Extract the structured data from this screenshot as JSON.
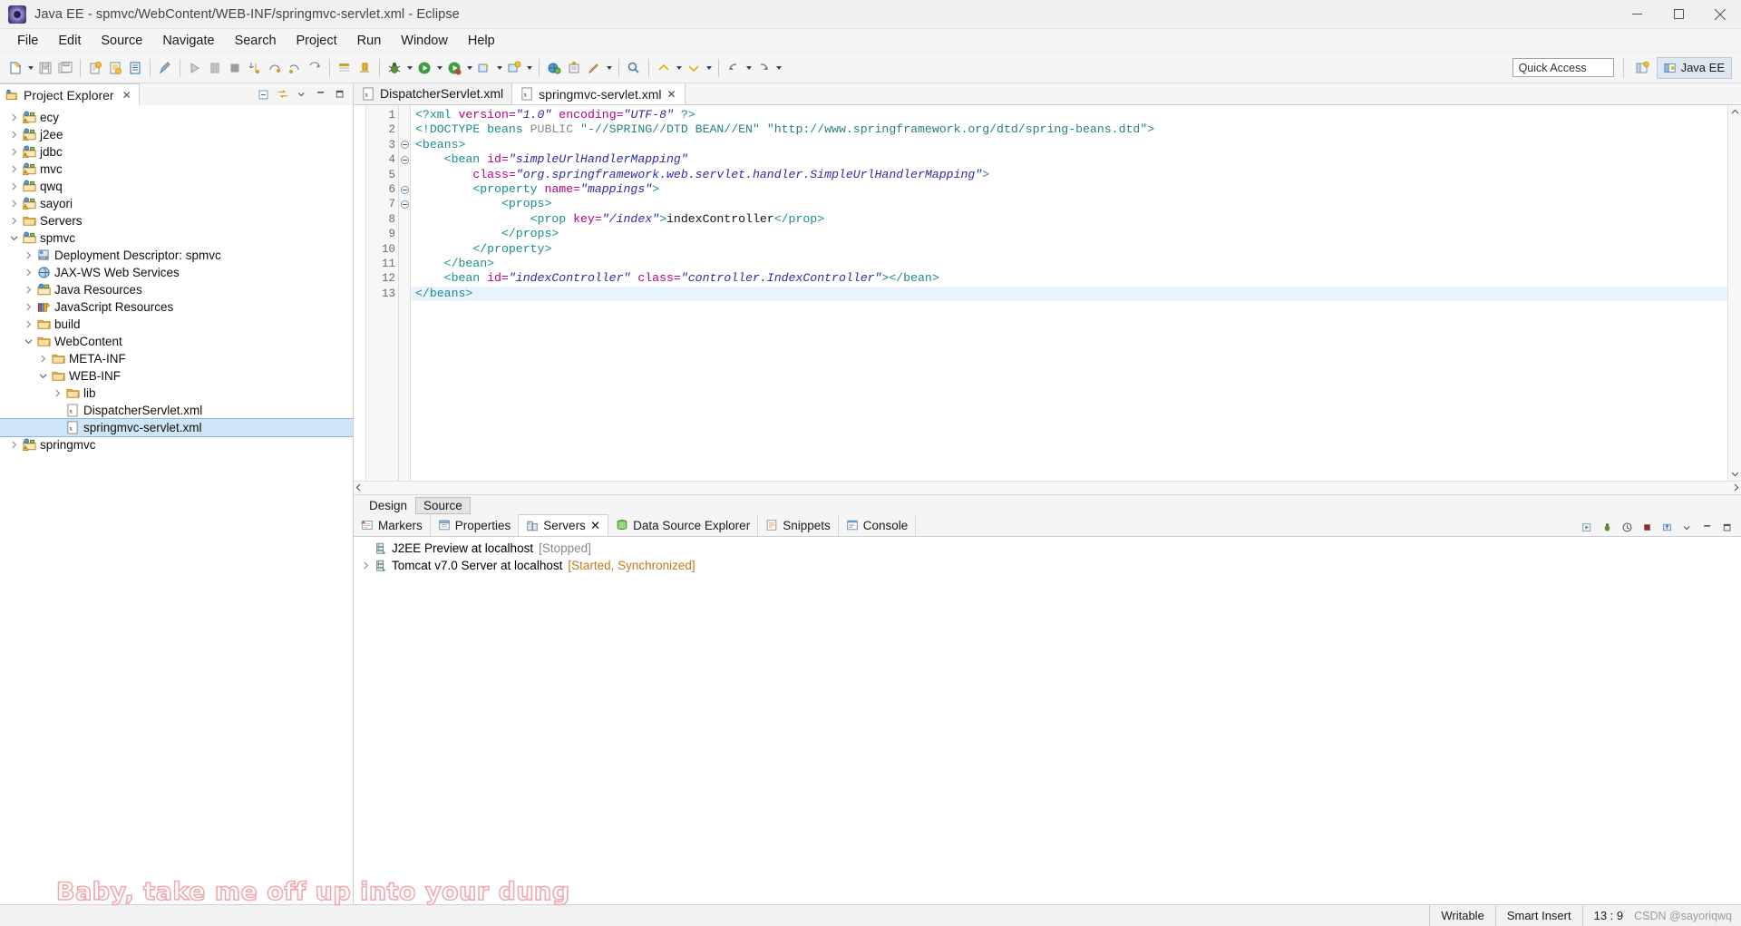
{
  "window": {
    "title": "Java EE - spmvc/WebContent/WEB-INF/springmvc-servlet.xml - Eclipse",
    "app_icon": "eclipse-icon",
    "minimize_label": "Minimize",
    "maximize_label": "Maximize",
    "close_label": "Close"
  },
  "menubar": {
    "items": [
      {
        "label": "File"
      },
      {
        "label": "Edit"
      },
      {
        "label": "Source"
      },
      {
        "label": "Navigate"
      },
      {
        "label": "Search"
      },
      {
        "label": "Project"
      },
      {
        "label": "Run"
      },
      {
        "label": "Window"
      },
      {
        "label": "Help"
      }
    ]
  },
  "toolbar": {
    "quick_access_placeholder": "Quick Access",
    "perspective_open_label": "Open Perspective",
    "perspective_active_label": "Java EE",
    "buttons": [
      {
        "name": "new-wizard-button",
        "icon": "new-file-icon"
      },
      {
        "name": "save-button",
        "icon": "save-icon"
      },
      {
        "name": "save-all-button",
        "icon": "save-all-icon"
      },
      {
        "name": "print-button",
        "icon": "print-icon"
      },
      {
        "name": "publish-button",
        "icon": "publish-icon"
      },
      {
        "name": "new-jsp-button",
        "icon": "document-icon"
      },
      {
        "name": "toggle-breakpoint-button",
        "icon": "pencil-icon"
      },
      {
        "name": "resume-button",
        "icon": "resume-icon"
      },
      {
        "name": "suspend-button",
        "icon": "suspend-icon"
      },
      {
        "name": "terminate-button",
        "icon": "terminate-icon"
      },
      {
        "name": "step-into-button",
        "icon": "step-into-icon"
      },
      {
        "name": "step-over-button",
        "icon": "step-over-icon"
      },
      {
        "name": "step-return-button",
        "icon": "step-return-icon"
      },
      {
        "name": "drop-to-frame-button",
        "icon": "drop-frame-icon"
      },
      {
        "name": "open-type-button",
        "icon": "open-type-icon"
      },
      {
        "name": "new-java-class-button",
        "icon": "java-class-icon"
      },
      {
        "name": "debug-button",
        "icon": "debug-bug-icon"
      },
      {
        "name": "run-button",
        "icon": "run-green-icon"
      },
      {
        "name": "run-server-button",
        "icon": "server-run-icon"
      },
      {
        "name": "external-tools-button",
        "icon": "external-tools-icon"
      },
      {
        "name": "new-project-button",
        "icon": "new-project-icon"
      },
      {
        "name": "new-folder-button",
        "icon": "new-folder-icon"
      },
      {
        "name": "edit-button",
        "icon": "edit-pencil-icon"
      },
      {
        "name": "search-button",
        "icon": "search-icon"
      },
      {
        "name": "open-task-button",
        "icon": "task-icon"
      },
      {
        "name": "previous-annotation-button",
        "icon": "prev-annotation-icon"
      },
      {
        "name": "next-annotation-button",
        "icon": "next-annotation-icon"
      },
      {
        "name": "back-button",
        "icon": "back-arrow-icon"
      },
      {
        "name": "forward-button",
        "icon": "forward-arrow-icon"
      }
    ]
  },
  "project_explorer": {
    "title": "Project Explorer",
    "close_glyph": "✕",
    "tools": [
      {
        "name": "collapse-all-button",
        "icon": "collapse-all-icon"
      },
      {
        "name": "link-with-editor-button",
        "icon": "link-editor-icon"
      },
      {
        "name": "view-menu-button",
        "icon": "view-menu-icon"
      },
      {
        "name": "minimize-view-button",
        "icon": "minimize-icon"
      },
      {
        "name": "maximize-view-button",
        "icon": "maximize-icon"
      }
    ],
    "tree": [
      {
        "label": "ecy",
        "indent": 0,
        "twisty": "collapsed",
        "icon": "java-project-warning-icon",
        "selected": false
      },
      {
        "label": "j2ee",
        "indent": 0,
        "twisty": "collapsed",
        "icon": "java-project-warning-icon",
        "selected": false
      },
      {
        "label": "jdbc",
        "indent": 0,
        "twisty": "collapsed",
        "icon": "java-project-warning-icon",
        "selected": false
      },
      {
        "label": "mvc",
        "indent": 0,
        "twisty": "collapsed",
        "icon": "java-project-warning-icon",
        "selected": false
      },
      {
        "label": "qwq",
        "indent": 0,
        "twisty": "collapsed",
        "icon": "java-project-icon",
        "selected": false
      },
      {
        "label": "sayori",
        "indent": 0,
        "twisty": "collapsed",
        "icon": "java-project-warning-icon",
        "selected": false
      },
      {
        "label": "Servers",
        "indent": 0,
        "twisty": "collapsed",
        "icon": "folder-icon",
        "selected": false
      },
      {
        "label": "spmvc",
        "indent": 0,
        "twisty": "expanded",
        "icon": "java-project-icon",
        "selected": false
      },
      {
        "label": "Deployment Descriptor: spmvc",
        "indent": 1,
        "twisty": "collapsed",
        "icon": "deployment-descriptor-icon",
        "selected": false
      },
      {
        "label": "JAX-WS Web Services",
        "indent": 1,
        "twisty": "collapsed",
        "icon": "jaxws-icon",
        "selected": false
      },
      {
        "label": "Java Resources",
        "indent": 1,
        "twisty": "collapsed",
        "icon": "java-resources-icon",
        "selected": false
      },
      {
        "label": "JavaScript Resources",
        "indent": 1,
        "twisty": "collapsed",
        "icon": "javascript-resources-icon",
        "selected": false
      },
      {
        "label": "build",
        "indent": 1,
        "twisty": "collapsed",
        "icon": "folder-icon",
        "selected": false
      },
      {
        "label": "WebContent",
        "indent": 1,
        "twisty": "expanded",
        "icon": "folder-icon",
        "selected": false
      },
      {
        "label": "META-INF",
        "indent": 2,
        "twisty": "collapsed",
        "icon": "folder-icon",
        "selected": false
      },
      {
        "label": "WEB-INF",
        "indent": 2,
        "twisty": "expanded",
        "icon": "folder-icon",
        "selected": false
      },
      {
        "label": "lib",
        "indent": 3,
        "twisty": "collapsed",
        "icon": "folder-icon",
        "selected": false
      },
      {
        "label": "DispatcherServlet.xml",
        "indent": 3,
        "twisty": "none",
        "icon": "xml-file-icon",
        "selected": false
      },
      {
        "label": "springmvc-servlet.xml",
        "indent": 3,
        "twisty": "none",
        "icon": "xml-file-icon",
        "selected": true
      },
      {
        "label": "springmvc",
        "indent": 0,
        "twisty": "collapsed",
        "icon": "java-project-warning-icon",
        "selected": false
      }
    ]
  },
  "editor": {
    "tabs": [
      {
        "label": "DispatcherServlet.xml",
        "icon": "xml-file-icon",
        "active": false,
        "closable": false
      },
      {
        "label": "springmvc-servlet.xml",
        "icon": "xml-file-icon",
        "active": true,
        "closable": true
      }
    ],
    "close_glyph": "✕",
    "bottom_tabs": [
      {
        "label": "Design",
        "active": false
      },
      {
        "label": "Source",
        "active": true
      }
    ],
    "lines": [
      {
        "no": "1",
        "fold": false,
        "current": false,
        "segments": [
          {
            "t": "tag",
            "s": "<?xml "
          },
          {
            "t": "attr",
            "s": "version="
          },
          {
            "t": "val",
            "s": "\"1.0\""
          },
          {
            "t": "plain",
            "s": " "
          },
          {
            "t": "attr",
            "s": "encoding="
          },
          {
            "t": "val",
            "s": "\"UTF-8\""
          },
          {
            "t": "tag",
            "s": " ?>"
          }
        ]
      },
      {
        "no": "2",
        "fold": false,
        "current": false,
        "segments": [
          {
            "t": "tag",
            "s": "<!DOCTYPE beans "
          },
          {
            "t": "dtk",
            "s": "PUBLIC "
          },
          {
            "t": "str",
            "s": "\"-//SPRING//DTD BEAN//EN\""
          },
          {
            "t": "plain",
            "s": " "
          },
          {
            "t": "str",
            "s": "\"http://www.springframework.org/dtd/spring-beans.dtd\">"
          }
        ]
      },
      {
        "no": "3",
        "fold": true,
        "current": false,
        "segments": [
          {
            "t": "tag",
            "s": "<beans>"
          }
        ]
      },
      {
        "no": "4",
        "fold": true,
        "current": false,
        "segments": [
          {
            "t": "plain",
            "s": "    "
          },
          {
            "t": "tag",
            "s": "<bean "
          },
          {
            "t": "attr",
            "s": "id="
          },
          {
            "t": "val",
            "s": "\"simpleUrlHandlerMapping\""
          }
        ]
      },
      {
        "no": "5",
        "fold": false,
        "current": false,
        "segments": [
          {
            "t": "plain",
            "s": "        "
          },
          {
            "t": "attr",
            "s": "class="
          },
          {
            "t": "val",
            "s": "\"org.springframework.web.servlet.handler.SimpleUrlHandlerMapping\""
          },
          {
            "t": "tag",
            "s": ">"
          }
        ]
      },
      {
        "no": "6",
        "fold": true,
        "current": false,
        "segments": [
          {
            "t": "plain",
            "s": "        "
          },
          {
            "t": "tag",
            "s": "<property "
          },
          {
            "t": "attr",
            "s": "name="
          },
          {
            "t": "val",
            "s": "\"mappings\""
          },
          {
            "t": "tag",
            "s": ">"
          }
        ]
      },
      {
        "no": "7",
        "fold": true,
        "current": false,
        "segments": [
          {
            "t": "plain",
            "s": "            "
          },
          {
            "t": "tag",
            "s": "<props>"
          }
        ]
      },
      {
        "no": "8",
        "fold": false,
        "current": false,
        "segments": [
          {
            "t": "plain",
            "s": "                "
          },
          {
            "t": "tag",
            "s": "<prop "
          },
          {
            "t": "attr",
            "s": "key="
          },
          {
            "t": "val",
            "s": "\"/index\""
          },
          {
            "t": "tag",
            "s": ">"
          },
          {
            "t": "txt",
            "s": "indexController"
          },
          {
            "t": "tag",
            "s": "</prop>"
          }
        ]
      },
      {
        "no": "9",
        "fold": false,
        "current": false,
        "segments": [
          {
            "t": "plain",
            "s": "            "
          },
          {
            "t": "tag",
            "s": "</props>"
          }
        ]
      },
      {
        "no": "10",
        "fold": false,
        "current": false,
        "segments": [
          {
            "t": "plain",
            "s": "        "
          },
          {
            "t": "tag",
            "s": "</property>"
          }
        ]
      },
      {
        "no": "11",
        "fold": false,
        "current": false,
        "segments": [
          {
            "t": "plain",
            "s": "    "
          },
          {
            "t": "tag",
            "s": "</bean>"
          }
        ]
      },
      {
        "no": "12",
        "fold": false,
        "current": false,
        "segments": [
          {
            "t": "plain",
            "s": "    "
          },
          {
            "t": "tag",
            "s": "<bean "
          },
          {
            "t": "attr",
            "s": "id="
          },
          {
            "t": "val",
            "s": "\"indexController\""
          },
          {
            "t": "plain",
            "s": " "
          },
          {
            "t": "attr",
            "s": "class="
          },
          {
            "t": "val",
            "s": "\"controller.IndexController\""
          },
          {
            "t": "tag",
            "s": "></bean>"
          }
        ]
      },
      {
        "no": "13",
        "fold": false,
        "current": true,
        "segments": [
          {
            "t": "tag",
            "s": "</beans>"
          }
        ]
      }
    ]
  },
  "bottom_panel": {
    "tabs": [
      {
        "label": "Markers",
        "icon": "markers-icon",
        "active": false,
        "closable": false
      },
      {
        "label": "Properties",
        "icon": "properties-icon",
        "active": false,
        "closable": false
      },
      {
        "label": "Servers",
        "icon": "servers-icon",
        "active": true,
        "closable": true
      },
      {
        "label": "Data Source Explorer",
        "icon": "datasource-icon",
        "active": false,
        "closable": false
      },
      {
        "label": "Snippets",
        "icon": "snippets-icon",
        "active": false,
        "closable": false
      },
      {
        "label": "Console",
        "icon": "console-icon",
        "active": false,
        "closable": false
      }
    ],
    "close_glyph": "✕",
    "tools": [
      {
        "name": "start-server-button",
        "icon": "start-icon"
      },
      {
        "name": "debug-server-button",
        "icon": "debug-icon"
      },
      {
        "name": "start-in-profile-button",
        "icon": "profile-icon"
      },
      {
        "name": "stop-server-button",
        "icon": "stop-icon"
      },
      {
        "name": "publish-server-button",
        "icon": "publish-icon"
      },
      {
        "name": "view-menu-button",
        "icon": "view-menu-icon"
      },
      {
        "name": "minimize-panel-button",
        "icon": "minimize-icon"
      },
      {
        "name": "maximize-panel-button",
        "icon": "maximize-icon"
      }
    ],
    "servers": [
      {
        "name": "J2EE Preview at localhost",
        "status": "[Stopped]",
        "status_kind": "stopped",
        "icon": "server-icon",
        "twisty": "none"
      },
      {
        "name": "Tomcat v7.0 Server at localhost",
        "status": "[Started, Synchronized]",
        "status_kind": "started",
        "icon": "server-icon",
        "twisty": "collapsed"
      }
    ]
  },
  "statusbar": {
    "writable": "Writable",
    "insert_mode": "Smart Insert",
    "position": "13 : 9",
    "credit": "CSDN @sayoriqwq"
  },
  "watermark": {
    "text": "Baby, take me off up into your dung",
    "color": "#f0a9ae"
  },
  "colors": {
    "tag": "#1a8c8c",
    "attr": "#b5007f",
    "value": "#2a2aa8",
    "text": "#111111",
    "selection": "#cde5f7",
    "current_line": "#eaf3fb"
  }
}
